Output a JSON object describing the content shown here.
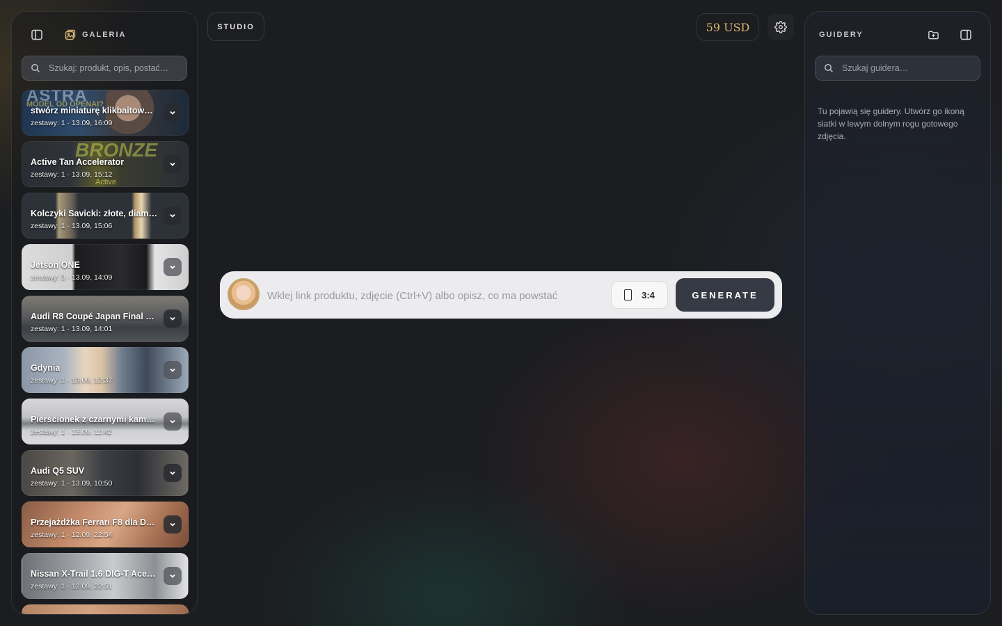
{
  "left_panel": {
    "title": "GALERIA",
    "search_placeholder": "Szukaj: produkt, opis, postać…",
    "items": [
      {
        "title": "stwórz miniaturę klikbaitową…",
        "meta": "zestawy: 1 · 13.09, 16:09"
      },
      {
        "title": "Active Tan Accelerator",
        "meta": "zestawy: 1 · 13.09, 15:12",
        "overlay": "Active"
      },
      {
        "title": "Kolczyki Savicki: złote, diam…",
        "meta": "zestawy: 1 · 13.09, 15:06"
      },
      {
        "title": "Jetson ONE",
        "meta": "zestawy: 3 · 13.09, 14:09"
      },
      {
        "title": "Audi R8 Coupé Japan Final E…",
        "meta": "zestawy: 1 · 13.09, 14:01"
      },
      {
        "title": "Gdynia",
        "meta": "zestawy: 1 · 13.09, 12:37"
      },
      {
        "title": "Pierścionek z czarnymi kami…",
        "meta": "zestawy: 1 · 13.09, 11:42"
      },
      {
        "title": "Audi Q5 SUV",
        "meta": "zestawy: 1 · 13.09, 10:50"
      },
      {
        "title": "Przejażdżka Ferrari F8 dla Dz…",
        "meta": "zestawy: 1 · 12.09, 22:54"
      },
      {
        "title": "Nissan X-Trail 1.6 DIG-T Ace…",
        "meta": "zestawy: 1 · 12.09, 22:51"
      }
    ]
  },
  "top_bar": {
    "studio_label": "STUDIO",
    "balance": "59 USD"
  },
  "prompt": {
    "placeholder": "Wklej link produktu, zdjęcie (Ctrl+V) albo opisz, co ma powstać",
    "aspect_ratio": "3:4",
    "generate_label": "GENERATE"
  },
  "right_panel": {
    "title": "GUIDERY",
    "search_placeholder": "Szukaj guidera…",
    "empty_text": "Tu pojawią się guidery. Utwórz go ikoną siatki w lewym dolnym rogu gotowego zdjęcia."
  },
  "colors": {
    "accent_gold": "#d8b676",
    "generate_bg": "#363a44"
  }
}
